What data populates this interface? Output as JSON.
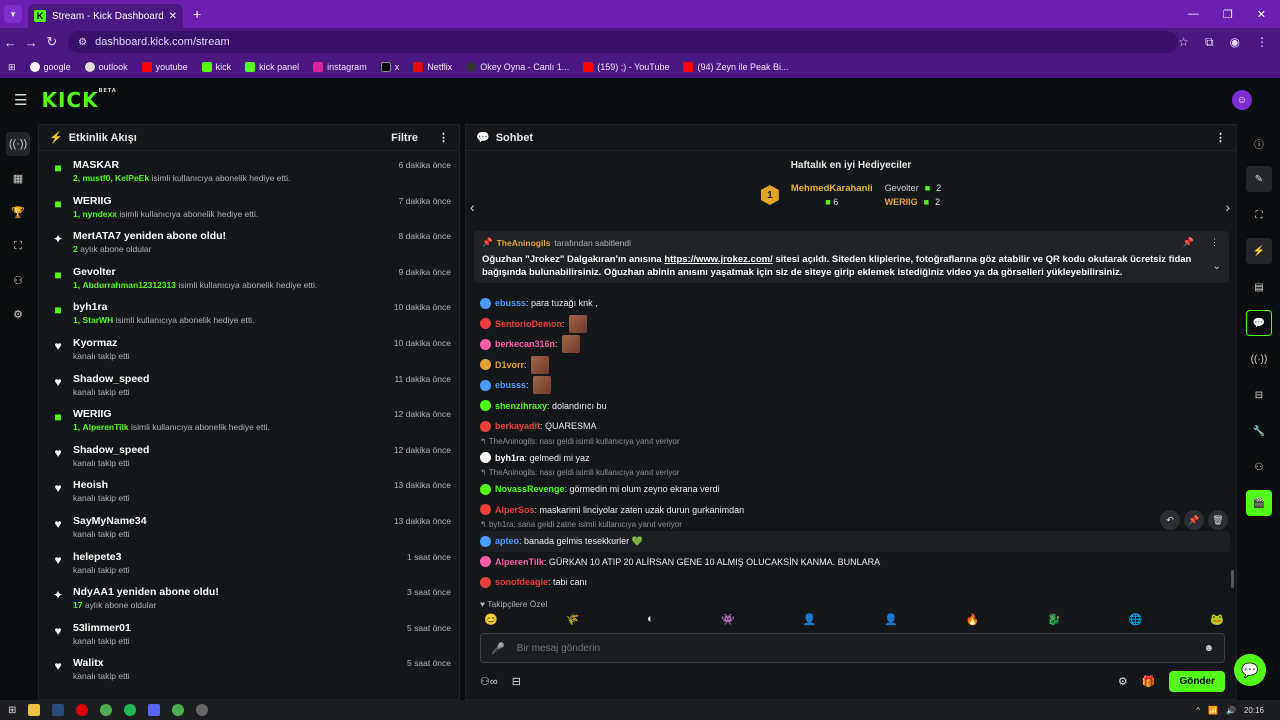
{
  "browser": {
    "tab_title": "Stream - Kick Dashboard",
    "url": "dashboard.kick.com/stream",
    "bookmarks": [
      "google",
      "outlook",
      "youtube",
      "kick",
      "kick panel",
      "instagram",
      "x",
      "Netflix",
      "Okey Oyna - Canlı 1...",
      "(159) ;) - YouTube",
      "(94) Zeyn ile Peak Bi..."
    ]
  },
  "header": {
    "logo": "KICK",
    "beta": "BETA"
  },
  "activity": {
    "title": "Etkinlik Akışı",
    "filter_label": "Filtre",
    "items": [
      {
        "type": "gift",
        "name": "MASKAR",
        "prefix": "2,",
        "users": "mustf0, KelPeEk",
        "desc": " isimli kullanıcıya abonelik hediye etti.",
        "time": "6 dakika önce"
      },
      {
        "type": "gift",
        "name": "WERIIG",
        "prefix": "1,",
        "users": "nyndexx",
        "desc": " isimli kullanıcıya abonelik hediye etti.",
        "time": "7 dakika önce"
      },
      {
        "type": "resub",
        "name": "MertATA7 yeniden abone oldu!",
        "prefix": "2",
        "users": "",
        "desc": " aylık abone oldular",
        "time": "8 dakika önce"
      },
      {
        "type": "gift",
        "name": "Gevolter",
        "prefix": "1,",
        "users": "Abdurrahman12312313",
        "desc": " isimli kullanıcıya abonelik hediye etti.",
        "time": "9 dakika önce"
      },
      {
        "type": "gift",
        "name": "byh1ra",
        "prefix": "1,",
        "users": "StarWH",
        "desc": " isimli kullanıcıya abonelik hediye etti.",
        "time": "10 dakika önce"
      },
      {
        "type": "follow",
        "name": "Kyormaz",
        "prefix": "",
        "users": "",
        "desc": "kanalı takip etti",
        "time": "10 dakika önce"
      },
      {
        "type": "follow",
        "name": "Shadow_speed",
        "prefix": "",
        "users": "",
        "desc": "kanalı takip etti",
        "time": "11 dakika önce"
      },
      {
        "type": "gift",
        "name": "WERIIG",
        "prefix": "1,",
        "users": "AlperenTilk",
        "desc": " isimli kullanıcıya abonelik hediye etti.",
        "time": "12 dakika önce"
      },
      {
        "type": "follow",
        "name": "Shadow_speed",
        "prefix": "",
        "users": "",
        "desc": "kanalı takip etti",
        "time": "12 dakika önce"
      },
      {
        "type": "follow",
        "name": "Heoish",
        "prefix": "",
        "users": "",
        "desc": "kanalı takip etti",
        "time": "13 dakika önce"
      },
      {
        "type": "follow",
        "name": "SayMyName34",
        "prefix": "",
        "users": "",
        "desc": "kanalı takip etti",
        "time": "13 dakika önce"
      },
      {
        "type": "follow",
        "name": "helepete3",
        "prefix": "",
        "users": "",
        "desc": "kanalı takip etti",
        "time": "1 saat önce"
      },
      {
        "type": "resub",
        "name": "NdyAA1 yeniden abone oldu!",
        "prefix": "17",
        "users": "",
        "desc": " aylık abone oldular",
        "time": "3 saat önce"
      },
      {
        "type": "follow",
        "name": "53limmer01",
        "prefix": "",
        "users": "",
        "desc": "kanalı takip etti",
        "time": "5 saat önce"
      },
      {
        "type": "follow",
        "name": "Walitx",
        "prefix": "",
        "users": "",
        "desc": "kanalı takip etti",
        "time": "5 saat önce"
      }
    ]
  },
  "chat": {
    "title": "Sohbet",
    "gifters_title": "Haftalık en iyi Hediyeciler",
    "top_gifter": {
      "rank": "1",
      "name": "MehmedKarahanli",
      "count": "6"
    },
    "gifters": [
      {
        "name": "Gevolter",
        "count": "2"
      },
      {
        "name": "WERIIG",
        "count": "2"
      }
    ],
    "pinned": {
      "by_user": "TheAninogils",
      "by_suffix": "tarafından sabitlendi",
      "text_before": "Oğuzhan \"Jrokez\" Dalgakıran'ın anısına ",
      "link": "https://www.jrokez.com/",
      "text_after": " sitesi açıldı. Siteden kliplerine, fotoğraflarına göz atabilir ve QR kodu okutarak ücretsiz fidan bağışında bulunabilirsiniz. Oğuzhan abinin anısını yaşatmak için siz de siteye girip eklemek istediğiniz video ya da görselleri yükleyebilirsiniz."
    },
    "messages": [
      {
        "user": "ebusss",
        "color": "#4a9cff",
        "text": ": para tuzağı knk ,",
        "emote": false,
        "reply": ""
      },
      {
        "user": "SentorioDemon",
        "color": "#e8403a",
        "text": ":",
        "emote": true,
        "reply": ""
      },
      {
        "user": "berkecan316n",
        "color": "#ff5ea8",
        "text": ":",
        "emote": true,
        "reply": ""
      },
      {
        "user": "D1vorr",
        "color": "#e7a23a",
        "text": ":",
        "emote": true,
        "reply": ""
      },
      {
        "user": "ebusss",
        "color": "#4a9cff",
        "text": ":",
        "emote": true,
        "reply": ""
      },
      {
        "user": "shenzihraxy",
        "color": "#53fc18",
        "text": ": dolandırıcı bu",
        "emote": false,
        "reply": ""
      },
      {
        "user": "berkayadit",
        "color": "#e8403a",
        "text": ": QUARESMA",
        "emote": false,
        "reply": ""
      },
      {
        "user": "byh1ra",
        "color": "#fff",
        "text": ": gelmedi mi yaz",
        "emote": false,
        "reply": "TheAninogils: nası geldi isimli kullanıcıya yanıt veriyor"
      },
      {
        "user": "NovassRevenge",
        "color": "#53fc18",
        "text": ": görmedin mi olum zeyno ekrana verdi",
        "emote": false,
        "reply": "TheAninogils: nası geldi isimli kullanıcıya yanıt veriyor"
      },
      {
        "user": "AlperSos",
        "color": "#e8403a",
        "text": ": maskarimi linciyolar zaten uzak durun gurkanimdan",
        "emote": false,
        "reply": ""
      },
      {
        "user": "apteo",
        "color": "#4a9cff",
        "text": ": banada gelmis tesekkurler 💚",
        "emote": false,
        "reply": "byh1ra: sana geldi zatne isimli kullanıcıya yanıt veriyor"
      },
      {
        "user": "AlperenTilk",
        "color": "#ff5ea8",
        "text": ": GÜRKAN 10 ATIP 20 ALİRSAN GENE 10 ALMIŞ OLUCAKSİN KANMA. BUNLARA",
        "emote": false,
        "reply": ""
      },
      {
        "user": "sonofdeagle",
        "color": "#e8403a",
        "text": ": tabi canı",
        "emote": false,
        "reply": ""
      }
    ],
    "followers_label": "Takipçilere Özel",
    "input_placeholder": "Bir mesaj gönderin",
    "send_label": "Gönder"
  },
  "taskbar": {
    "time": "20:16"
  }
}
